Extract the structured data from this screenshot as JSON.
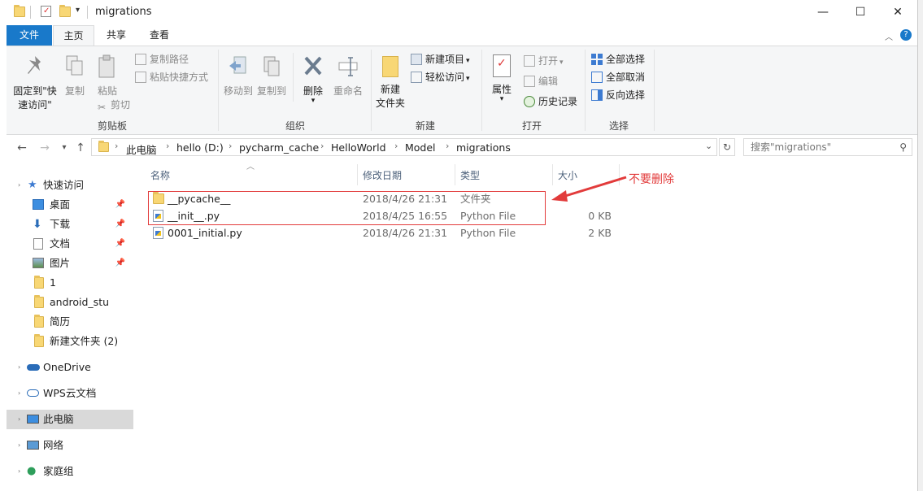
{
  "window": {
    "title": "migrations",
    "controls": {
      "minimize": "—",
      "maximize": "☐",
      "close": "✕"
    }
  },
  "tabs": [
    {
      "label": "文件"
    },
    {
      "label": "主页"
    },
    {
      "label": "共享"
    },
    {
      "label": "查看"
    }
  ],
  "ribbon": {
    "clipboard": {
      "label": "剪贴板",
      "pin_label_1": "固定到\"快",
      "pin_label_2": "速访问\"",
      "copy": "复制",
      "paste": "粘贴",
      "copy_path": "复制路径",
      "paste_shortcut": "粘贴快捷方式",
      "cut": "剪切"
    },
    "organize": {
      "label": "组织",
      "move_to": "移动到",
      "copy_to": "复制到",
      "delete": "删除",
      "rename": "重命名"
    },
    "new": {
      "label": "新建",
      "new_folder_1": "新建",
      "new_folder_2": "文件夹",
      "new_item": "新建项目",
      "easy_access": "轻松访问"
    },
    "open": {
      "label": "打开",
      "properties": "属性",
      "open": "打开",
      "edit": "编辑",
      "history": "历史记录"
    },
    "select": {
      "label": "选择",
      "select_all": "全部选择",
      "select_none": "全部取消",
      "invert": "反向选择"
    }
  },
  "address": {
    "crumbs": [
      "此电脑",
      "hello (D:)",
      "pycharm_cache",
      "HelloWorld",
      "Model",
      "migrations"
    ],
    "search_placeholder": "搜索\"migrations\""
  },
  "nav": [
    {
      "label": "快速访问",
      "icon": "star-icon"
    },
    {
      "label": "桌面",
      "icon": "desktop-icon",
      "pinned": true
    },
    {
      "label": "下载",
      "icon": "download-icon",
      "pinned": true
    },
    {
      "label": "文档",
      "icon": "document-icon",
      "pinned": true
    },
    {
      "label": "图片",
      "icon": "pictures-icon",
      "pinned": true
    },
    {
      "label": "1",
      "icon": "folder-icon"
    },
    {
      "label": "android_stu",
      "icon": "folder-icon"
    },
    {
      "label": "简历",
      "icon": "folder-icon"
    },
    {
      "label": "新建文件夹 (2)",
      "icon": "folder-icon"
    },
    {
      "label": "OneDrive",
      "icon": "cloud-icon"
    },
    {
      "label": "WPS云文档",
      "icon": "wps-cloud-icon"
    },
    {
      "label": "此电脑",
      "icon": "computer-icon"
    },
    {
      "label": "网络",
      "icon": "network-icon"
    },
    {
      "label": "家庭组",
      "icon": "homegroup-icon"
    }
  ],
  "columns": {
    "name": "名称",
    "date": "修改日期",
    "type": "类型",
    "size": "大小"
  },
  "files": [
    {
      "name": "__pycache__",
      "date": "2018/4/26 21:31",
      "type": "文件夹",
      "size": "",
      "icon": "folder-icon"
    },
    {
      "name": "__init__.py",
      "date": "2018/4/25 16:55",
      "type": "Python File",
      "size": "0 KB",
      "icon": "python-file-icon"
    },
    {
      "name": "0001_initial.py",
      "date": "2018/4/26 21:31",
      "type": "Python File",
      "size": "2 KB",
      "icon": "python-file-icon"
    }
  ],
  "annotation": {
    "text": "不要删除",
    "color": "#e23b3b"
  },
  "colors": {
    "file_tab": "#1979ca",
    "ribbon_bg": "#f5f6f7",
    "selected_nav": "#d9d9d9"
  }
}
